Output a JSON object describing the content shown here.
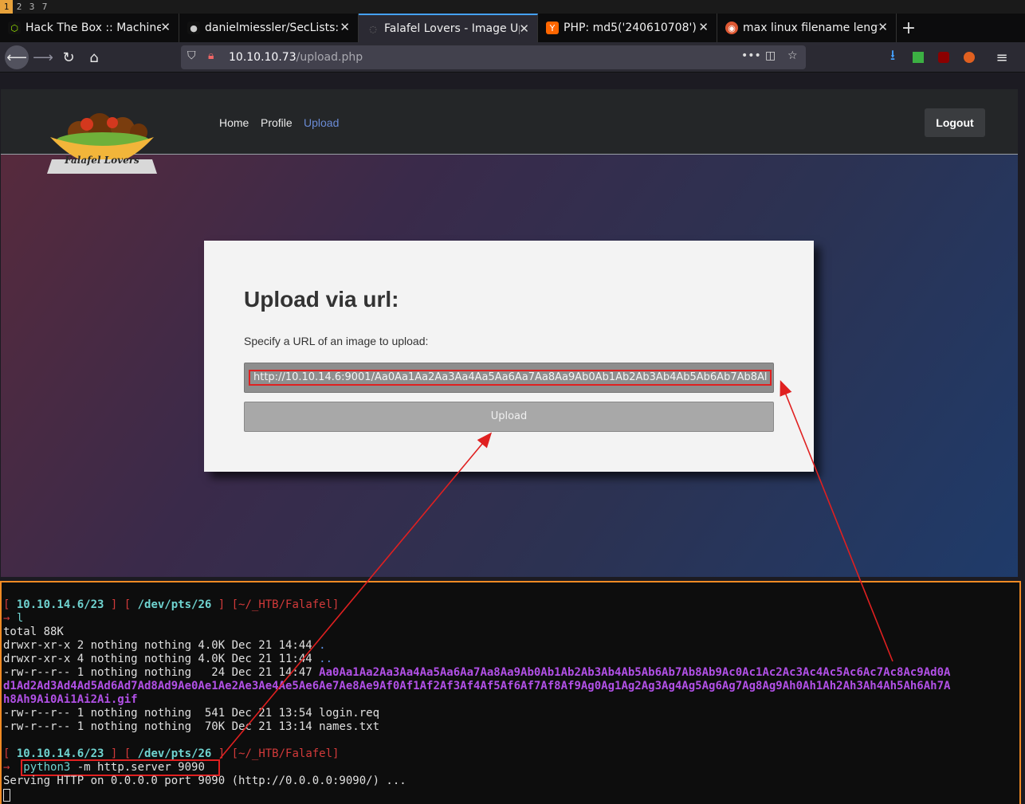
{
  "workspaces": [
    "1",
    "2",
    "3",
    "7"
  ],
  "tabs": [
    {
      "title": "Hack The Box :: Machine",
      "icon": "htb-cube-icon",
      "favicon": "⬡",
      "favicon_bg": "#111",
      "favicon_fg": "#9fef00"
    },
    {
      "title": "danielmiessler/SecLists:",
      "icon": "github-icon",
      "favicon": "●",
      "favicon_bg": "#111",
      "favicon_fg": "#ccc"
    },
    {
      "title": "Falafel Lovers - Image Up",
      "icon": "loading-icon",
      "favicon": "◌",
      "favicon_bg": "#2b2a33",
      "favicon_fg": "#777"
    },
    {
      "title": "PHP: md5('240610708')",
      "icon": "ycombinator-icon",
      "favicon": "Y",
      "favicon_bg": "#ff6600",
      "favicon_fg": "#fff"
    },
    {
      "title": "max linux filename lengt",
      "icon": "duckduckgo-icon",
      "favicon": "◉",
      "favicon_bg": "#de5833",
      "favicon_fg": "#fff"
    }
  ],
  "active_tab": 2,
  "url": {
    "host": "10.10.10.73",
    "path": "/upload.php"
  },
  "site": {
    "logo_text": "Falafel Lovers",
    "nav": [
      {
        "label": "Home"
      },
      {
        "label": "Profile"
      },
      {
        "label": "Upload"
      }
    ],
    "logout_label": "Logout"
  },
  "form": {
    "title": "Upload via url:",
    "label": "Specify a URL of an image to upload:",
    "url_value": "http://10.10.14.6:9001/Aa0Aa1Aa2Aa3Aa4Aa5Aa6Aa7Aa8Aa9Ab0Ab1Ab2Ab3Ab4Ab5Ab6Ab7Ab8Al",
    "button_label": "Upload"
  },
  "terminal": {
    "prompt1": {
      "ip": "10.10.14.6/23",
      "pts": "/dev/pts/26",
      "cwd": "[~/_HTB/Falafel]"
    },
    "cmd1": "l",
    "total": "total 88K",
    "rows": [
      {
        "perm": "drwxr-xr-x 2 nothing nothing 4.0K Dec 21 14:44 ",
        "name": "."
      },
      {
        "perm": "drwxr-xr-x 4 nothing nothing 4.0K Dec 21 11:44 ",
        "name": ".."
      },
      {
        "perm": "-rw-r--r-- 1 nothing nothing   24 Dec 21 14:47 ",
        "name": "Aa0Aa1Aa2Aa3Aa4Aa5Aa6Aa7Aa8Aa9Ab0Ab1Ab2Ab3Ab4Ab5Ab6Ab7Ab8Ab9Ac0Ac1Ac2Ac3Ac4Ac5Ac6Ac7Ac8Ac9Ad0A"
      },
      {
        "perm": "",
        "name": "d1Ad2Ad3Ad4Ad5Ad6Ad7Ad8Ad9Ae0Ae1Ae2Ae3Ae4Ae5Ae6Ae7Ae8Ae9Af0Af1Af2Af3Af4Af5Af6Af7Af8Af9Ag0Ag1Ag2Ag3Ag4Ag5Ag6Ag7Ag8Ag9Ah0Ah1Ah2Ah3Ah4Ah5Ah6Ah7A"
      },
      {
        "perm": "",
        "name": "h8Ah9Ai0Ai1Ai2Ai.gif"
      },
      {
        "perm": "-rw-r--r-- 1 nothing nothing  541 Dec 21 13:54 ",
        "name": "login.req"
      },
      {
        "perm": "-rw-r--r-- 1 nothing nothing  70K Dec 21 13:14 ",
        "name": "names.txt"
      }
    ],
    "prompt2": {
      "ip": "10.10.14.6/23",
      "pts": "/dev/pts/26",
      "cwd": "[~/_HTB/Falafel]"
    },
    "cmd2_bin": "python3",
    "cmd2_args": " -m http.server 9090",
    "serving": "Serving HTTP on 0.0.0.0 port 9090 (http://0.0.0.0:9090/) ..."
  },
  "colors": {
    "annotation": "#e02020",
    "terminal_border": "#f08a24",
    "active_link": "#6a8bd6"
  }
}
